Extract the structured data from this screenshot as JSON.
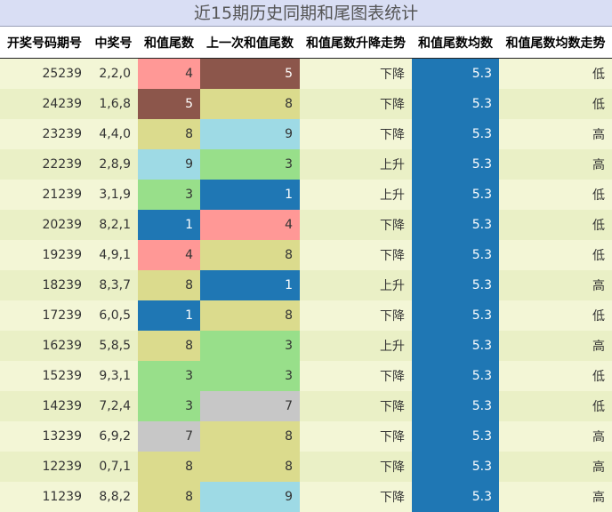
{
  "title": "近15期历史同期和尾图表统计",
  "columns": [
    "开奖号码期号",
    "中奖号",
    "和值尾数",
    "上一次和值尾数",
    "和值尾数升降走势",
    "和值尾数均数",
    "和值尾数均数走势"
  ],
  "value_colors": {
    "1": "#1f77b4",
    "3": "#98df8a",
    "4": "#ff9896",
    "5": "#8c564b",
    "7": "#c7c7c7",
    "8": "#dbdb8d",
    "9": "#9edae5"
  },
  "average_color": "#1f77b4",
  "rows": [
    {
      "issue": "25239",
      "numbers": "2,2,0",
      "tail": "4",
      "prev_tail": "5",
      "trend": "下降",
      "avg": "5.3",
      "avg_trend": "低"
    },
    {
      "issue": "24239",
      "numbers": "1,6,8",
      "tail": "5",
      "prev_tail": "8",
      "trend": "下降",
      "avg": "5.3",
      "avg_trend": "低"
    },
    {
      "issue": "23239",
      "numbers": "4,4,0",
      "tail": "8",
      "prev_tail": "9",
      "trend": "下降",
      "avg": "5.3",
      "avg_trend": "高"
    },
    {
      "issue": "22239",
      "numbers": "2,8,9",
      "tail": "9",
      "prev_tail": "3",
      "trend": "上升",
      "avg": "5.3",
      "avg_trend": "高"
    },
    {
      "issue": "21239",
      "numbers": "3,1,9",
      "tail": "3",
      "prev_tail": "1",
      "trend": "上升",
      "avg": "5.3",
      "avg_trend": "低"
    },
    {
      "issue": "20239",
      "numbers": "8,2,1",
      "tail": "1",
      "prev_tail": "4",
      "trend": "下降",
      "avg": "5.3",
      "avg_trend": "低"
    },
    {
      "issue": "19239",
      "numbers": "4,9,1",
      "tail": "4",
      "prev_tail": "8",
      "trend": "下降",
      "avg": "5.3",
      "avg_trend": "低"
    },
    {
      "issue": "18239",
      "numbers": "8,3,7",
      "tail": "8",
      "prev_tail": "1",
      "trend": "上升",
      "avg": "5.3",
      "avg_trend": "高"
    },
    {
      "issue": "17239",
      "numbers": "6,0,5",
      "tail": "1",
      "prev_tail": "8",
      "trend": "下降",
      "avg": "5.3",
      "avg_trend": "低"
    },
    {
      "issue": "16239",
      "numbers": "5,8,5",
      "tail": "8",
      "prev_tail": "3",
      "trend": "上升",
      "avg": "5.3",
      "avg_trend": "高"
    },
    {
      "issue": "15239",
      "numbers": "9,3,1",
      "tail": "3",
      "prev_tail": "3",
      "trend": "下降",
      "avg": "5.3",
      "avg_trend": "低"
    },
    {
      "issue": "14239",
      "numbers": "7,2,4",
      "tail": "3",
      "prev_tail": "7",
      "trend": "下降",
      "avg": "5.3",
      "avg_trend": "低"
    },
    {
      "issue": "13239",
      "numbers": "6,9,2",
      "tail": "7",
      "prev_tail": "8",
      "trend": "下降",
      "avg": "5.3",
      "avg_trend": "高"
    },
    {
      "issue": "12239",
      "numbers": "0,7,1",
      "tail": "8",
      "prev_tail": "8",
      "trend": "下降",
      "avg": "5.3",
      "avg_trend": "高"
    },
    {
      "issue": "11239",
      "numbers": "8,8,2",
      "tail": "8",
      "prev_tail": "9",
      "trend": "下降",
      "avg": "5.3",
      "avg_trend": "高"
    }
  ]
}
